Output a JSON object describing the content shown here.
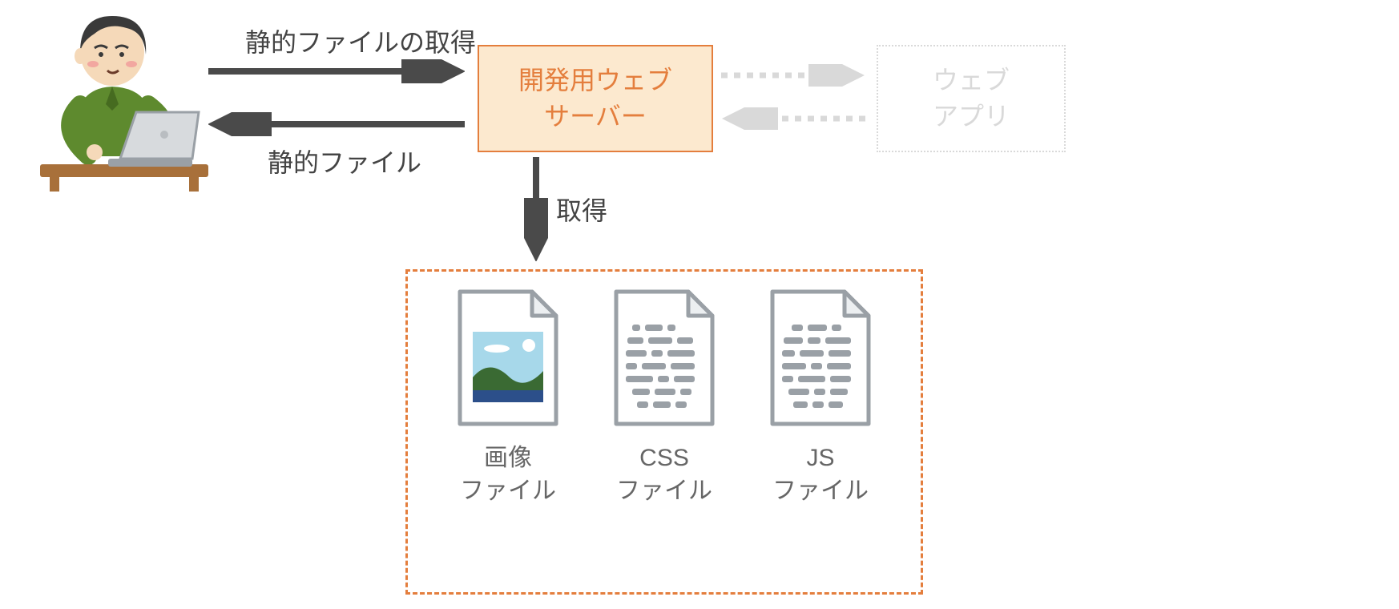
{
  "arrows": {
    "to_server_label": "静的ファイルの取得",
    "from_server_label": "静的ファイル",
    "fetch_label": "取得"
  },
  "server": {
    "line1": "開発用ウェブ",
    "line2": "サーバー"
  },
  "webapp": {
    "line1": "ウェブ",
    "line2": "アプリ"
  },
  "files": {
    "image": {
      "line1": "画像",
      "line2": "ファイル"
    },
    "css": {
      "line1": "CSS",
      "line2": "ファイル"
    },
    "js": {
      "line1": "JS",
      "line2": "ファイル"
    }
  }
}
